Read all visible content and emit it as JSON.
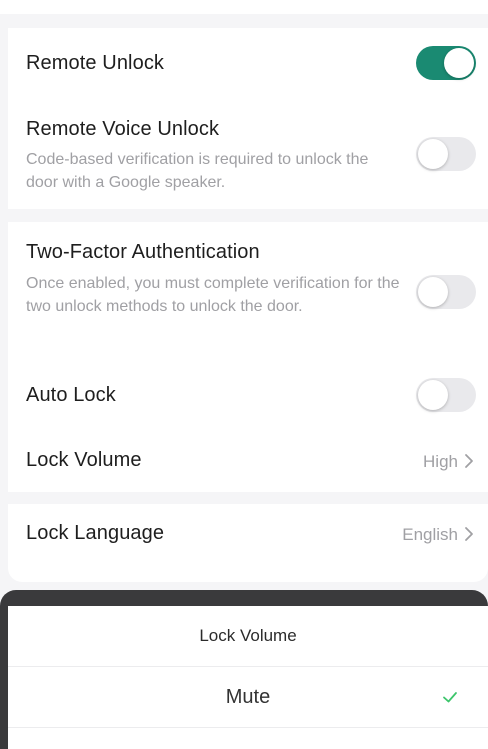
{
  "settings": {
    "remote_unlock": {
      "title": "Remote Unlock",
      "enabled": true
    },
    "remote_voice_unlock": {
      "title": "Remote Voice Unlock",
      "description": "Code-based verification is required to unlock the door with a Google speaker.",
      "enabled": false
    },
    "two_factor": {
      "title": "Two-Factor Authentication",
      "description": "Once enabled, you must complete verification for the two unlock methods to unlock the door.",
      "enabled": false
    },
    "auto_lock": {
      "title": "Auto Lock",
      "enabled": false
    },
    "lock_volume": {
      "title": "Lock Volume",
      "value": "High"
    },
    "lock_language": {
      "title": "Lock Language",
      "value": "English"
    }
  },
  "sheet": {
    "title": "Lock Volume",
    "options": [
      {
        "label": "Mute",
        "selected": true
      }
    ]
  },
  "colors": {
    "accent": "#1a8a72",
    "check": "#3cc56b",
    "toggle_off": "#e9e9ec",
    "sheet_header": "#3a3a3c"
  },
  "icons": {
    "chevron": "chevron-right-icon",
    "check": "check-icon"
  }
}
